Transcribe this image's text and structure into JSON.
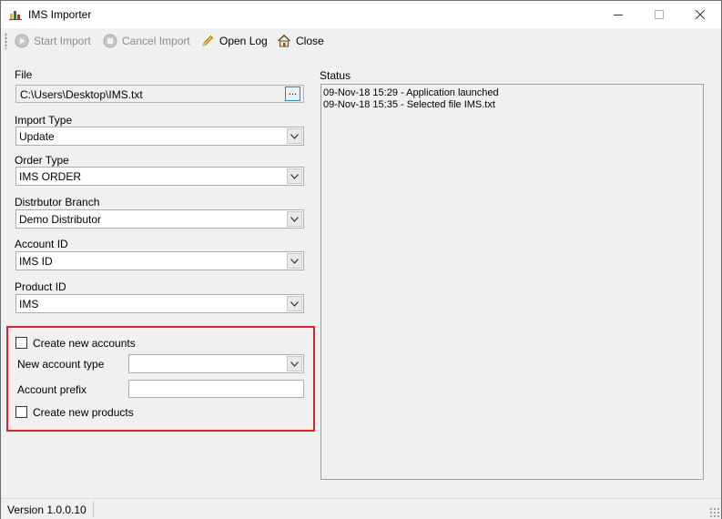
{
  "window": {
    "title": "IMS Importer",
    "app_icon": "bar-chart-icon",
    "controls": [
      "minimize-icon",
      "maximize-icon",
      "close-icon"
    ]
  },
  "toolbar": {
    "start_import": {
      "label": "Start Import",
      "icon": "play-icon",
      "enabled": false
    },
    "cancel_import": {
      "label": "Cancel Import",
      "icon": "stop-icon",
      "enabled": false
    },
    "open_log": {
      "label": "Open Log",
      "icon": "pencil-icon",
      "enabled": true
    },
    "close": {
      "label": "Close",
      "icon": "home-icon",
      "enabled": true
    }
  },
  "form": {
    "file": {
      "label": "File",
      "value": "C:\\Users\\Desktop\\IMS.txt",
      "browse_label": "..."
    },
    "import_type": {
      "label": "Import Type",
      "value": "Update"
    },
    "order_type": {
      "label": "Order Type",
      "value": "IMS ORDER"
    },
    "distributor_branch": {
      "label": "Distrbutor Branch",
      "value": "Demo Distributor"
    },
    "account_id": {
      "label": "Account ID",
      "value": "IMS ID"
    },
    "product_id": {
      "label": "Product ID",
      "value": "IMS"
    },
    "create_new_accounts": {
      "label": "Create new accounts",
      "checked": false
    },
    "new_account_type": {
      "label": "New account type",
      "value": ""
    },
    "account_prefix": {
      "label": "Account prefix",
      "value": ""
    },
    "create_new_products": {
      "label": "Create new products",
      "checked": false
    }
  },
  "status": {
    "label": "Status",
    "lines": [
      "09-Nov-18 15:29 - Application launched",
      "09-Nov-18 15:35 - Selected file IMS.txt"
    ]
  },
  "statusbar": {
    "version": "Version 1.0.0.10"
  },
  "colors": {
    "highlight": "#e0202a",
    "window_bg": "#f0f0f0"
  }
}
